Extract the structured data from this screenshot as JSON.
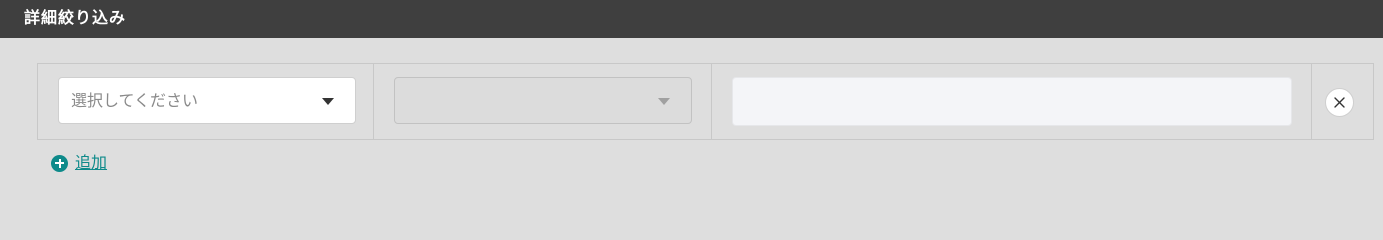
{
  "header": {
    "title": "詳細絞り込み"
  },
  "filter_row": {
    "field_select": {
      "placeholder": "選択してください",
      "icon": "caret-down-icon"
    },
    "operator_select": {
      "value": "",
      "disabled": true,
      "icon": "caret-down-icon"
    },
    "value_input": {
      "value": ""
    },
    "remove_button": {
      "icon": "close-icon"
    }
  },
  "add_link": {
    "label": "追加",
    "icon": "plus-circle-icon"
  },
  "colors": {
    "header_bg": "#3f3f3f",
    "panel_bg": "#dedede",
    "accent": "#0e8a8a",
    "input_bg": "#f4f5f8"
  }
}
